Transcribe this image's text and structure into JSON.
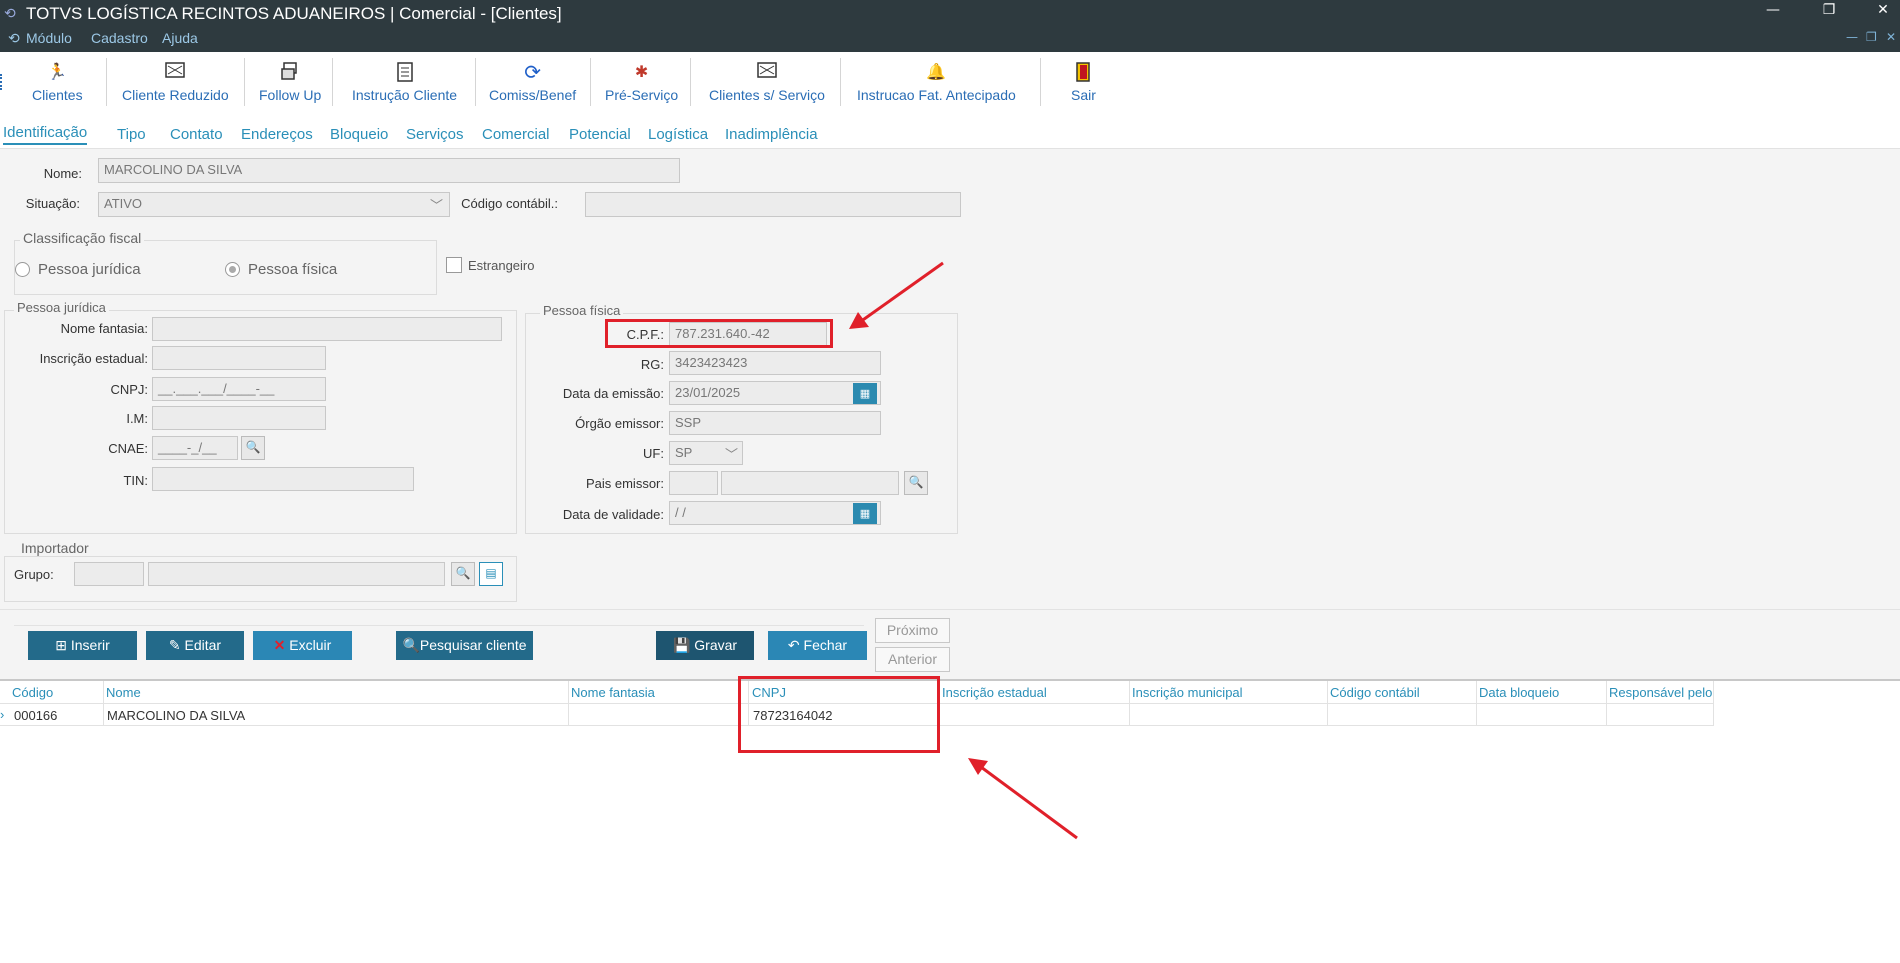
{
  "window": {
    "title": "TOTVS LOGÍSTICA RECINTOS ADUANEIROS | Comercial - [Clientes]",
    "menu": [
      "Módulo",
      "Cadastro",
      "Ajuda"
    ],
    "controls": {
      "minimize": "—",
      "restore": "❐",
      "close": "✕"
    }
  },
  "toolbar": {
    "items": [
      {
        "label": "Clientes",
        "icon": "runner-icon"
      },
      {
        "label": "Cliente Reduzido",
        "icon": "card-icon"
      },
      {
        "label": "Follow Up",
        "icon": "followup-icon"
      },
      {
        "label": "Instrução Cliente",
        "icon": "document-icon"
      },
      {
        "label": "Comiss/Benef",
        "icon": "refresh-icon"
      },
      {
        "label": "Pré-Serviço",
        "icon": "wrench-icon"
      },
      {
        "label": "Clientes s/ Serviço",
        "icon": "card-icon"
      },
      {
        "label": "Instrucao Fat. Antecipado",
        "icon": "bell-icon"
      },
      {
        "label": "Sair",
        "icon": "exit-door-icon"
      }
    ]
  },
  "tabs": [
    "Identificação",
    "Tipo",
    "Contato",
    "Endereços",
    "Bloqueio",
    "Serviços",
    "Comercial",
    "Potencial",
    "Logística",
    "Inadimplência"
  ],
  "form": {
    "nome_label": "Nome:",
    "nome_value": "MARCOLINO DA SILVA",
    "situacao_label": "Situação:",
    "situacao_value": "ATIVO",
    "codigo_contabil_label": "Código contábil.:",
    "codigo_contabil_value": "",
    "classificacao_title": "Classificação fiscal",
    "pessoa_juridica_radio": "Pessoa jurídica",
    "pessoa_fisica_radio": "Pessoa física",
    "estrangeiro_label": "Estrangeiro",
    "pj": {
      "title": "Pessoa jurídica",
      "nome_fantasia_label": "Nome fantasia:",
      "inscricao_estadual_label": "Inscrição estadual:",
      "cnpj_label": "CNPJ:",
      "cnpj_mask": "__.___.___/____-__",
      "im_label": "I.M:",
      "cnae_label": "CNAE:",
      "cnae_mask": "____-_/__",
      "tin_label": "TIN:"
    },
    "pf": {
      "title": "Pessoa física",
      "cpf_label": "C.P.F.:",
      "cpf_value": "787.231.640.-42",
      "rg_label": "RG:",
      "rg_value": "3423423423",
      "data_emissao_label": "Data da emissão:",
      "data_emissao_value": "23/01/2025",
      "orgao_label": "Órgão emissor:",
      "orgao_value": "SSP",
      "uf_label": "UF:",
      "uf_value": "SP",
      "pais_label": "Pais emissor:",
      "validade_label": "Data de validade:",
      "validade_value": " / /"
    },
    "importador": {
      "title": "Importador",
      "grupo_label": "Grupo:"
    }
  },
  "actions": {
    "inserir": "Inserir",
    "editar": "Editar",
    "excluir": "Excluir",
    "pesquisar": "Pesquisar cliente",
    "gravar": "Gravar",
    "fechar": "Fechar",
    "proximo": "Próximo",
    "anterior": "Anterior"
  },
  "grid": {
    "columns": [
      "Código",
      "Nome",
      "Nome fantasia",
      "CNPJ",
      "Inscrição estadual",
      "Inscrição municipal",
      "Código contábil",
      "Data bloqueio",
      "Responsável pelo"
    ],
    "rows": [
      {
        "codigo": "000166",
        "nome": "MARCOLINO DA SILVA",
        "nome_fantasia": "",
        "cnpj": "78723164042",
        "inscricao_estadual": "",
        "inscricao_municipal": "",
        "codigo_contabil": "",
        "data_bloqueio": "",
        "responsavel": ""
      }
    ]
  },
  "annotations": {
    "highlight_color": "#e0202a"
  }
}
